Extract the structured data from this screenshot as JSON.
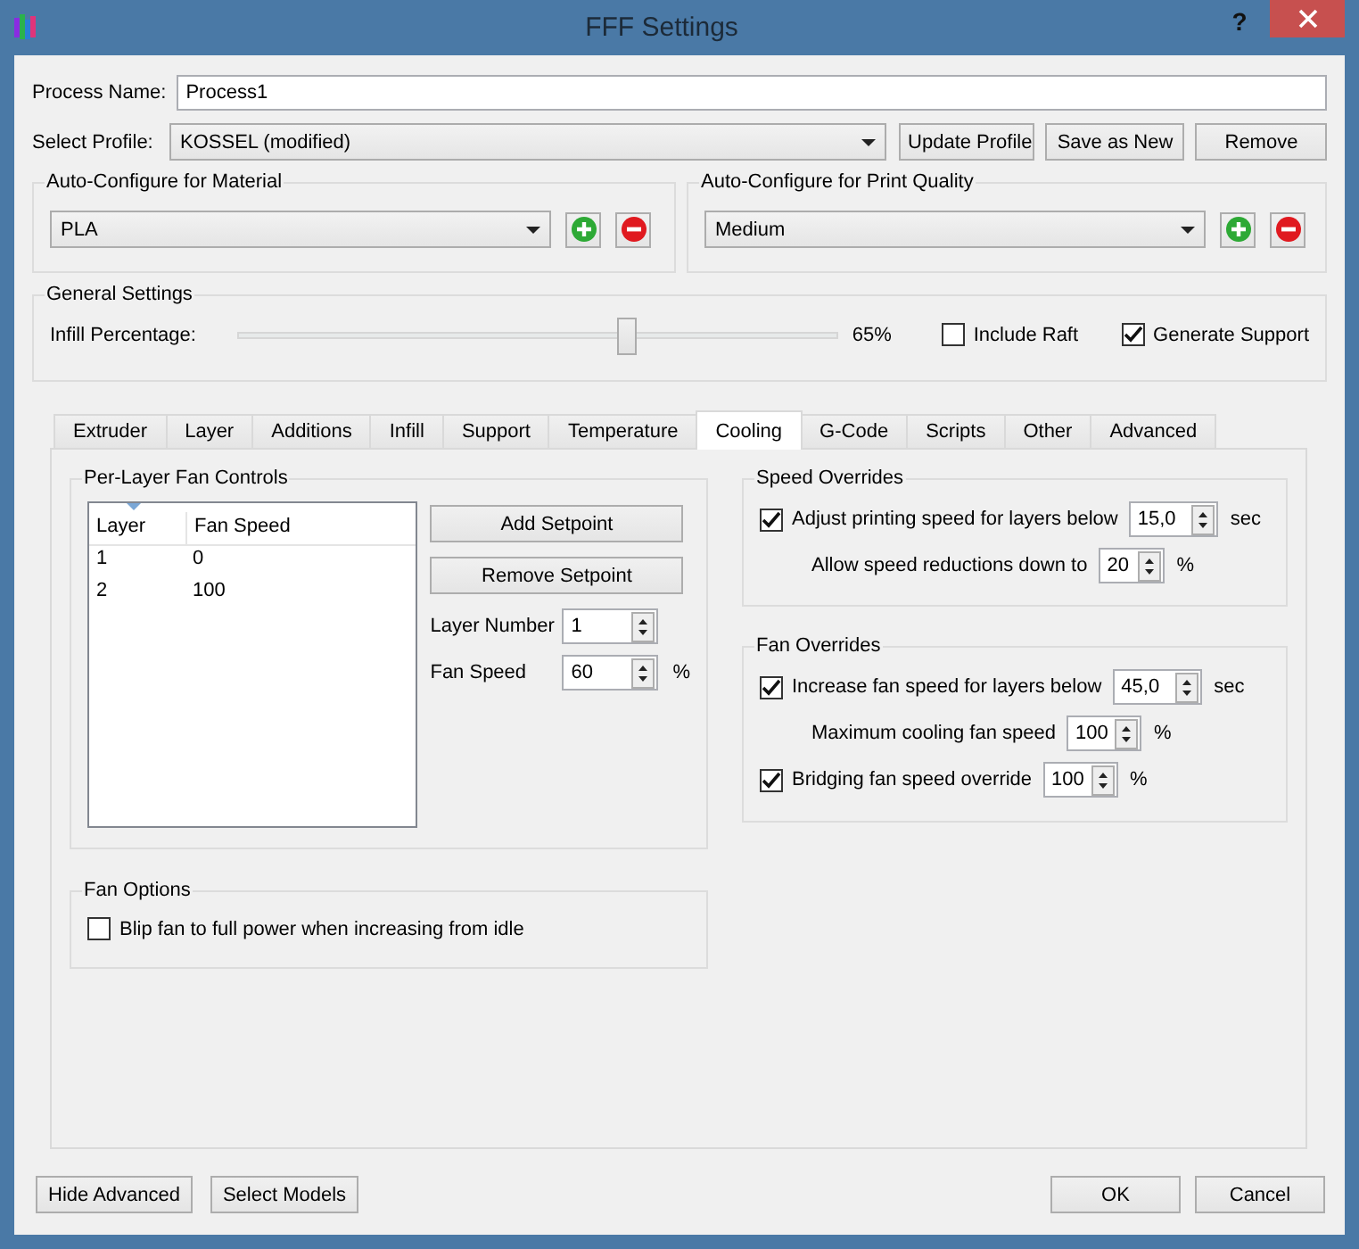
{
  "window": {
    "title": "FFF Settings",
    "help": "?"
  },
  "process_name": {
    "label": "Process Name:",
    "value": "Process1"
  },
  "profile": {
    "label": "Select Profile:",
    "value": "KOSSEL (modified)",
    "buttons": [
      "Update Profile",
      "Save as New",
      "Remove"
    ]
  },
  "material": {
    "title": "Auto-Configure for Material",
    "value": "PLA"
  },
  "quality": {
    "title": "Auto-Configure for Print Quality",
    "value": "Medium"
  },
  "general": {
    "title": "General Settings",
    "infill_label": "Infill Percentage:",
    "level": 0.65,
    "reading": "65%",
    "options": [
      {
        "label": "Include Raft",
        "checked": false
      },
      {
        "label": "Generate Support",
        "checked": true
      }
    ]
  },
  "tabs": [
    {
      "label": "Extruder",
      "selected": false
    },
    {
      "label": "Layer",
      "selected": false
    },
    {
      "label": "Additions",
      "selected": false
    },
    {
      "label": "Infill",
      "selected": false
    },
    {
      "label": "Support",
      "selected": false
    },
    {
      "label": "Temperature",
      "selected": false
    },
    {
      "label": "Cooling",
      "selected": true
    },
    {
      "label": "G-Code",
      "selected": false
    },
    {
      "label": "Scripts",
      "selected": false
    },
    {
      "label": "Other",
      "selected": false
    },
    {
      "label": "Advanced",
      "selected": false
    }
  ],
  "fan_controls": {
    "title": "Per-Layer Fan Controls",
    "columns": [
      "Layer",
      "Fan Speed"
    ],
    "rows": [
      [
        "1",
        "0"
      ],
      [
        "2",
        "100"
      ]
    ],
    "buttons": [
      "Add Setpoint",
      "Remove Setpoint"
    ],
    "fields": [
      {
        "label": "Layer Number",
        "value": "1"
      },
      {
        "label": "Fan Speed",
        "value": "60",
        "unit": "%"
      }
    ]
  },
  "fan_options": {
    "title": "Fan Options",
    "options": [
      {
        "label": "Blip fan to full power when increasing from idle",
        "checked": false
      }
    ]
  },
  "speed_overrides": {
    "title": "Speed Overrides",
    "rows": [
      {
        "kind": "check",
        "label": "Adjust printing speed for layers below",
        "checked": true,
        "value": "15,0",
        "unit": "sec"
      },
      {
        "kind": "sub",
        "label": "Allow speed reductions down to",
        "value": "20",
        "unit": "%"
      }
    ]
  },
  "fan_overrides": {
    "title": "Fan Overrides",
    "rows": [
      {
        "kind": "check",
        "label": "Increase fan speed for layers below",
        "checked": true,
        "value": "45,0",
        "unit": "sec"
      },
      {
        "kind": "sub",
        "label": "Maximum cooling fan speed",
        "value": "100",
        "unit": "%"
      },
      {
        "kind": "check",
        "label": "Bridging fan speed override",
        "checked": true,
        "value": "100",
        "unit": "%"
      }
    ]
  },
  "footer": {
    "left": [
      "Hide Advanced",
      "Select Models"
    ],
    "right": [
      "OK",
      "Cancel"
    ]
  }
}
